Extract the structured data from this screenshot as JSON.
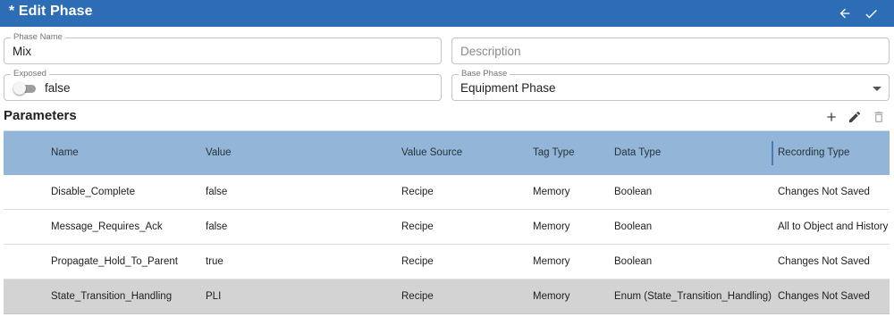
{
  "titlebar": {
    "title": "* Edit Phase",
    "back_icon": "arrow-left-icon",
    "confirm_icon": "check-icon"
  },
  "form": {
    "phase_name": {
      "label": "Phase Name",
      "value": "Mix"
    },
    "description": {
      "placeholder": "Description",
      "value": ""
    },
    "exposed": {
      "label": "Exposed",
      "value": "false",
      "checked": false
    },
    "base_phase": {
      "label": "Base Phase",
      "value": "Equipment Phase"
    }
  },
  "parameters": {
    "title": "Parameters",
    "tools": [
      "plus-icon",
      "pencil-icon",
      "trash-icon"
    ],
    "columns": [
      "Name",
      "Value",
      "Value Source",
      "Tag Type",
      "Data Type",
      "Recording Type"
    ],
    "rows": [
      {
        "name": "Disable_Complete",
        "value": "false",
        "value_source": "Recipe",
        "tag_type": "Memory",
        "data_type": "Boolean",
        "recording_type": "Changes Not Saved",
        "selected": false
      },
      {
        "name": "Message_Requires_Ack",
        "value": "false",
        "value_source": "Recipe",
        "tag_type": "Memory",
        "data_type": "Boolean",
        "recording_type": "All to Object and History",
        "selected": false
      },
      {
        "name": "Propagate_Hold_To_Parent",
        "value": "true",
        "value_source": "Recipe",
        "tag_type": "Memory",
        "data_type": "Boolean",
        "recording_type": "Changes Not Saved",
        "selected": false
      },
      {
        "name": "State_Transition_Handling",
        "value": "PLI",
        "value_source": "Recipe",
        "tag_type": "Memory",
        "data_type": "Enum (State_Transition_Handling)",
        "recording_type": "Changes Not Saved",
        "selected": true
      }
    ]
  },
  "colors": {
    "titlebar": "#2d6db5",
    "table_header": "#93b5d8",
    "selected_row": "#d3d3d3"
  }
}
